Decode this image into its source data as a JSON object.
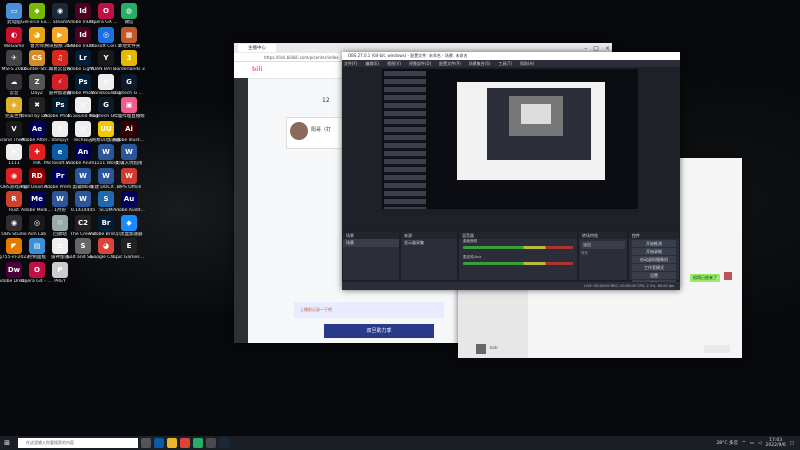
{
  "desktop": {
    "icons": [
      {
        "label": "此电脑",
        "color": "#4a90d9",
        "glyph": "▭"
      },
      {
        "label": "GeForce Experience",
        "color": "#76b900",
        "glyph": "◆"
      },
      {
        "label": "Steam",
        "color": "#1b2838",
        "glyph": "◉"
      },
      {
        "label": "Adobe InDesi...",
        "color": "#49021f",
        "glyph": "Id"
      },
      {
        "label": "Opera GX 浏览器",
        "color": "#c01045",
        "glyph": "O"
      },
      {
        "label": "微信",
        "color": "#2aae67",
        "glyph": "◍"
      },
      {
        "label": "WeGame",
        "color": "#c8102e",
        "glyph": "◐"
      },
      {
        "label": "鲁大师",
        "color": "#e8a317",
        "glyph": "◕"
      },
      {
        "label": "腾讯视频 3577",
        "color": "#f5a623",
        "glyph": "▶"
      },
      {
        "label": "Adobe InDesi...",
        "color": "#49021f",
        "glyph": "Id"
      },
      {
        "label": "Ubisoft Connect",
        "color": "#1e6ee1",
        "glyph": "◎"
      },
      {
        "label": "本地文件夹",
        "color": "#c05a2a",
        "glyph": "▦"
      },
      {
        "label": "MSFS 2020",
        "color": "#444",
        "glyph": "✈"
      },
      {
        "label": "Counter-Str... Global Off...",
        "color": "#d28d2a",
        "glyph": "CS"
      },
      {
        "label": "网易云音乐",
        "color": "#d7281f",
        "glyph": "♫"
      },
      {
        "label": "Adobe Lightroo...",
        "color": "#001e36",
        "glyph": "Lr"
      },
      {
        "label": "YUAN BATTLEFIE...",
        "color": "#1a1a1a",
        "glyph": "Y"
      },
      {
        "label": "Borderlands 3",
        "color": "#e6b800",
        "glyph": "3"
      },
      {
        "label": "云音",
        "color": "#333",
        "glyph": "☁"
      },
      {
        "label": "DayZ",
        "color": "#555",
        "glyph": "Z"
      },
      {
        "label": "雷神加速器",
        "color": "#d01f26",
        "glyph": "⚡"
      },
      {
        "label": "Adobe Photosh...",
        "color": "#001e36",
        "glyph": "Ps"
      },
      {
        "label": "Windsound 1",
        "color": "#eee",
        "glyph": "≡"
      },
      {
        "label": "Logitech G HUB",
        "color": "#0d1a2b",
        "glyph": "G"
      },
      {
        "label": "完美世界",
        "color": "#e0b030",
        "glyph": "◈"
      },
      {
        "label": "Dead by Daylight",
        "color": "#222",
        "glyph": "✖"
      },
      {
        "label": "Adobe Photosh...",
        "color": "#001e36",
        "glyph": "Ps"
      },
      {
        "label": "In Sound Mod",
        "color": "#eee",
        "glyph": "≡"
      },
      {
        "label": "Logitech G HUB",
        "color": "#0d1a2b",
        "glyph": "G"
      },
      {
        "label": "哔哩哔哩直播姬",
        "color": "#f45a8d",
        "glyph": "▣"
      },
      {
        "label": "Grand Theft Auto V",
        "color": "#1a1a1a",
        "glyph": "V"
      },
      {
        "label": "Adobe After Effects 2022",
        "color": "#00005b",
        "glyph": "Ae"
      },
      {
        "label": "Vampyr",
        "color": "#eee",
        "glyph": "≡"
      },
      {
        "label": "Tech日志",
        "color": "#eee",
        "glyph": "≡"
      },
      {
        "label": "网易UU加速器",
        "color": "#f2c900",
        "glyph": "UU"
      },
      {
        "label": "Adobe Illustrat...",
        "color": "#330000",
        "glyph": "Ai"
      },
      {
        "label": "1111",
        "color": "#eee",
        "glyph": "≡"
      },
      {
        "label": "HiK",
        "color": "#e02020",
        "glyph": "✚"
      },
      {
        "label": "Microsoft Edge",
        "color": "#0c59a4",
        "glyph": "e"
      },
      {
        "label": "Adobe Anima...",
        "color": "#00005b",
        "glyph": "An"
      },
      {
        "label": "1111 Word",
        "color": "#2b579a",
        "glyph": "W"
      },
      {
        "label": "剪辑入坑指南",
        "color": "#2b579a",
        "glyph": "W"
      },
      {
        "label": "OBS游戏声音",
        "color": "#e02020",
        "glyph": "◉"
      },
      {
        "label": "Red Dead Redempti...",
        "color": "#8b0000",
        "glyph": "RD"
      },
      {
        "label": "Adobe Premiere...",
        "color": "#00005b",
        "glyph": "Pr"
      },
      {
        "label": "剪辑Word",
        "color": "#2b579a",
        "glyph": "W"
      },
      {
        "label": "新建 DOCX 文档.docx",
        "color": "#2b579a",
        "glyph": "W"
      },
      {
        "label": "WPS Office",
        "color": "#d03a2c",
        "glyph": "W"
      },
      {
        "label": "Rust",
        "color": "#ce422b",
        "glyph": "R"
      },
      {
        "label": "Adobe Media...",
        "color": "#00005b",
        "glyph": "Me"
      },
      {
        "label": "1月份",
        "color": "#2b579a",
        "glyph": "W"
      },
      {
        "label": "0.1414445",
        "color": "#2b579a",
        "glyph": "W"
      },
      {
        "label": "SCUM",
        "color": "#1e6ab0",
        "glyph": "S"
      },
      {
        "label": "Adobe Audit...",
        "color": "#00005b",
        "glyph": "Au"
      },
      {
        "label": "OBS Studio",
        "color": "#302e31",
        "glyph": "◉"
      },
      {
        "label": "Aim Lab",
        "color": "#1a1a1a",
        "glyph": "◎"
      },
      {
        "label": "回收站",
        "color": "#9aa",
        "glyph": "♲"
      },
      {
        "label": "The Crew 2",
        "color": "#222",
        "glyph": "C2"
      },
      {
        "label": "Adobe Bridge 2022",
        "color": "#001e36",
        "glyph": "Br"
      },
      {
        "label": "小黑盒加速器",
        "color": "#1a8cff",
        "glyph": "◆"
      },
      {
        "label": "g755-in-2022",
        "color": "#e07b00",
        "glyph": "◤"
      },
      {
        "label": "控制面板",
        "color": "#3b8fd9",
        "glyph": "▤"
      },
      {
        "label": "雷神加速",
        "color": "#eee",
        "glyph": "≡"
      },
      {
        "label": "Salt and Sanctuary",
        "color": "#666",
        "glyph": "S"
      },
      {
        "label": "Google Chrome",
        "color": "#db4437",
        "glyph": "◕"
      },
      {
        "label": "Epic Games Launcher",
        "color": "#222",
        "glyph": "E"
      },
      {
        "label": "Adobe Dreamwe...",
        "color": "#470137",
        "glyph": "Dw"
      },
      {
        "label": "Opera GX - The Fi...",
        "color": "#c01045",
        "glyph": "O"
      },
      {
        "label": "PREY",
        "color": "#ccc",
        "glyph": "P"
      }
    ]
  },
  "browser": {
    "tab_title": "主播中心",
    "url": "https://link.bilibili.com/p/center/index",
    "streamer_name": "阳哥（打",
    "number": "12",
    "banner_text": "上播前记录一下吧",
    "bottom_banner": "双旦助力季"
  },
  "obs": {
    "title": "OBS 27.0.1 (64-bit, windows) - 配置文件: 未命名 - 场景: 未命名",
    "menu": [
      "文件(F)",
      "编辑(E)",
      "视图(V)",
      "停靠部件(D)",
      "配置文件(P)",
      "场景集合(S)",
      "工具(T)",
      "帮助(H)"
    ],
    "panels": {
      "scenes": "场景",
      "sources": "来源",
      "mixer": "混音器",
      "transitions": "转场特效",
      "controls": "控件"
    },
    "scene_item": "场景",
    "source_item": "显示器采集",
    "mixer_tracks": [
      "桌面音频",
      "麦克风/Aux"
    ],
    "transition_value": "淡出",
    "duration_label": "时长",
    "duration_value": "300 ms",
    "controls": [
      "开始推流",
      "开始录制",
      "启动虚拟摄像机",
      "工作室模式",
      "设置",
      "退出"
    ],
    "status": "LIVE: 00:00:00  REC: 00:00:00  CPU: 2.3%, 60.00 fps",
    "no_selection": "未选择源"
  },
  "chat": {
    "bubble": "阳哥已经来了",
    "contact": "bob"
  },
  "taskbar": {
    "search_placeholder": "在这里输入你要搜索的内容",
    "weather": "28°C 多云",
    "time": "17:03",
    "date": "2022/9/6"
  }
}
